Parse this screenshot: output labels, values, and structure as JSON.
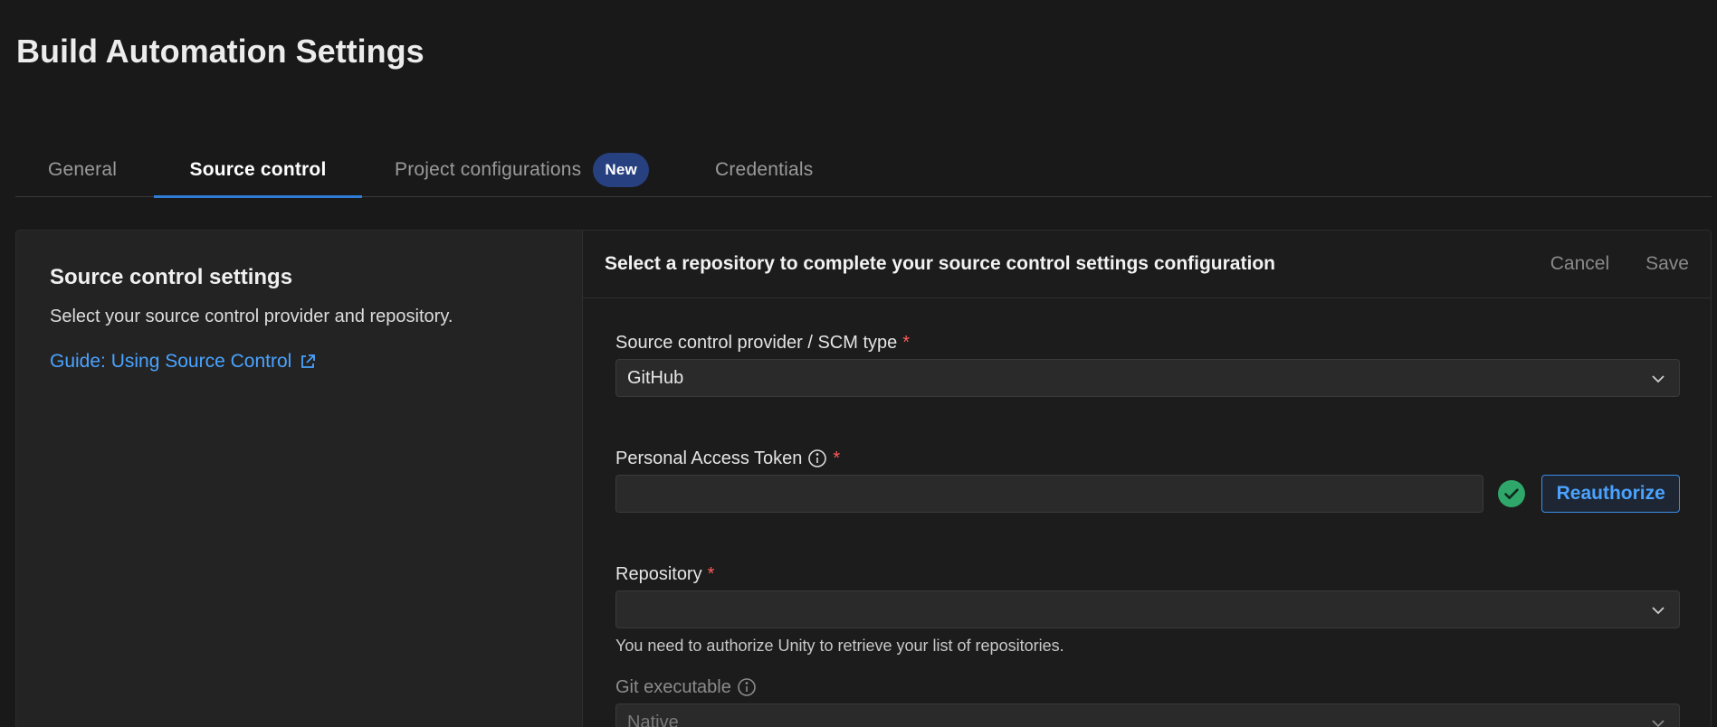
{
  "page": {
    "title": "Build Automation Settings"
  },
  "tabs": [
    {
      "label": "General"
    },
    {
      "label": "Source control"
    },
    {
      "label": "Project configurations",
      "badge": "New"
    },
    {
      "label": "Credentials"
    }
  ],
  "left_panel": {
    "title": "Source control settings",
    "description": "Select your source control provider and repository.",
    "guide_link": "Guide: Using Source Control"
  },
  "right_panel": {
    "header_title": "Select a repository to complete your source control settings configuration",
    "cancel_label": "Cancel",
    "save_label": "Save"
  },
  "form": {
    "provider": {
      "label": "Source control provider / SCM type",
      "required": "*",
      "value": "GitHub"
    },
    "token": {
      "label": "Personal Access Token",
      "required": "*",
      "value": "",
      "reauthorize_label": "Reauthorize"
    },
    "repository": {
      "label": "Repository",
      "required": "*",
      "value": "",
      "helper": "You need to authorize Unity to retrieve your list of repositories."
    },
    "git_executable": {
      "label": "Git executable",
      "value": "Native"
    }
  },
  "colors": {
    "accent": "#2f7dd7",
    "link": "#4aa3ff",
    "required": "#ff5a5a",
    "success": "#2fa66a",
    "badge_bg": "#27407f"
  }
}
